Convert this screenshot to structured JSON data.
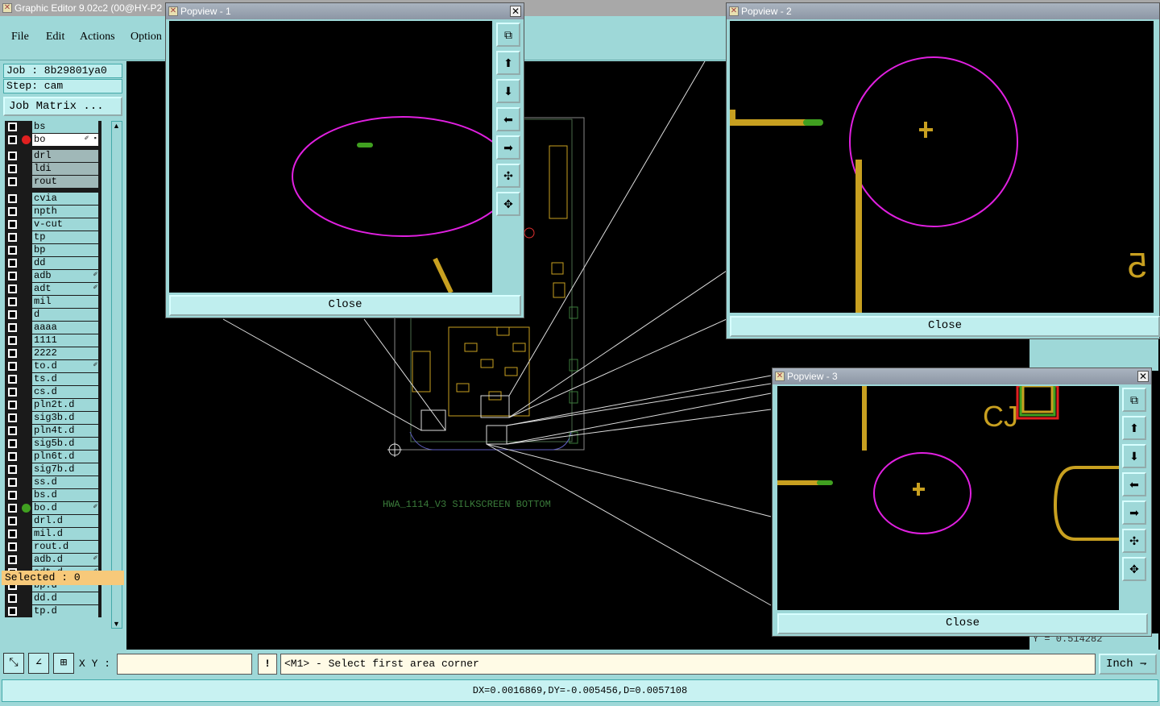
{
  "window": {
    "title": "Graphic Editor 9.02c2 (00@HY-P2"
  },
  "menu": {
    "items": [
      "File",
      "Edit",
      "Actions",
      "Option"
    ]
  },
  "job": {
    "job_label": "Job : 8b29801ya0",
    "step_label": "Step: cam",
    "matrix_button": "Job Matrix ..."
  },
  "layers": [
    {
      "name": "bs",
      "style": "normal"
    },
    {
      "name": "bo",
      "style": "sel",
      "dot": "#e02020",
      "mark": "✐ ▪"
    },
    {
      "name": "drl",
      "style": "grey"
    },
    {
      "name": "ldi",
      "style": "grey"
    },
    {
      "name": "rout",
      "style": "grey"
    },
    {
      "name": "cvia"
    },
    {
      "name": "npth"
    },
    {
      "name": "v-cut"
    },
    {
      "name": "tp"
    },
    {
      "name": "bp"
    },
    {
      "name": "dd"
    },
    {
      "name": "adb",
      "mark": "✐"
    },
    {
      "name": "adt",
      "mark": "✐"
    },
    {
      "name": "mil"
    },
    {
      "name": "d"
    },
    {
      "name": "aaaa"
    },
    {
      "name": "1111"
    },
    {
      "name": "2222"
    },
    {
      "name": "to.d",
      "mark": "✐"
    },
    {
      "name": "ts.d"
    },
    {
      "name": "cs.d"
    },
    {
      "name": "pln2t.d"
    },
    {
      "name": "sig3b.d"
    },
    {
      "name": "pln4t.d"
    },
    {
      "name": "sig5b.d"
    },
    {
      "name": "pln6t.d"
    },
    {
      "name": "sig7b.d"
    },
    {
      "name": "ss.d"
    },
    {
      "name": "bs.d"
    },
    {
      "name": "bo.d",
      "dot": "#40a020",
      "mark": "✐"
    },
    {
      "name": "drl.d"
    },
    {
      "name": "mil.d"
    },
    {
      "name": "rout.d"
    },
    {
      "name": "adb.d",
      "mark": "✐"
    },
    {
      "name": "adt.d",
      "mark": "✐"
    },
    {
      "name": "bp.d"
    },
    {
      "name": "dd.d"
    },
    {
      "name": "tp.d"
    }
  ],
  "selected": {
    "label": "Selected : 0"
  },
  "canvas": {
    "silkscreen_text": "HWA_1114_V3 SILKSCREEN BOTTOM"
  },
  "popviews": [
    {
      "title": "Popview - 1",
      "close": "Close"
    },
    {
      "title": "Popview - 2",
      "close": "Close"
    },
    {
      "title": "Popview - 3",
      "close": "Close"
    }
  ],
  "cmd": {
    "xy_label": "X Y :",
    "xy_value": "",
    "info": "!",
    "prompt": "<M1> - Select first area corner",
    "unit": "Inch ⇁"
  },
  "status": {
    "text": "DX=0.0016869,DY=-0.005456,D=0.0057108"
  },
  "partial": {
    "readout": "Y = 0.514282"
  },
  "colors": {
    "panel": "#9ed8d8",
    "canvas": "#000000",
    "trace": "#c8a020",
    "circle": "#e020e0",
    "pad": "#40a020"
  }
}
